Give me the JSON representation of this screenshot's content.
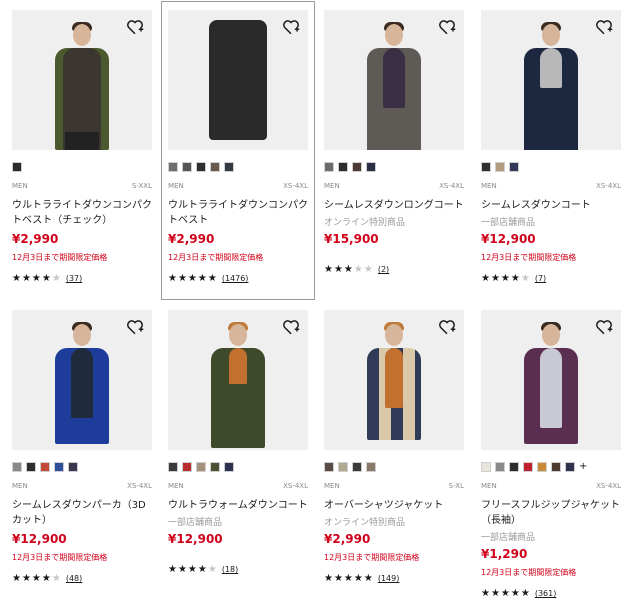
{
  "products": [
    {
      "gender": "MEN",
      "size": "S-XXL",
      "name": "ウルトラライトダウンコンパクトベスト（チェック）",
      "tag": "",
      "price": "¥2,990",
      "note": "12月3日まで期間限定価格",
      "rating": 4,
      "count": "(37)",
      "swatches": [
        "#2b2b2b"
      ],
      "coat": "#3d3a31"
    },
    {
      "gender": "MEN",
      "size": "XS-4XL",
      "name": "ウルトラライトダウンコンパクトベスト",
      "tag": "",
      "price": "¥2,990",
      "note": "12月3日まで期間限定価格",
      "rating": 4.5,
      "count": "(1476)",
      "swatches": [
        "#6f6f6f",
        "#555555",
        "#2f2f2f",
        "#6b5a4c",
        "#333a45"
      ],
      "coat": "#2a2a2a"
    },
    {
      "gender": "MEN",
      "size": "XS-4XL",
      "name": "シームレスダウンロングコート",
      "tag": "オンライン特別商品",
      "price": "¥15,900",
      "note": "",
      "rating": 2.5,
      "count": "(2)",
      "swatches": [
        "#6c6c6c",
        "#2d2d2d",
        "#4a3a33",
        "#2b2f45"
      ],
      "coat": "#5e5b57"
    },
    {
      "gender": "MEN",
      "size": "XS-4XL",
      "name": "シームレスダウンコート",
      "tag": "一部店舗商品",
      "price": "¥12,900",
      "note": "12月3日まで期間限定価格",
      "rating": 3.5,
      "count": "(7)",
      "swatches": [
        "#2f2f2f",
        "#b19c80",
        "#303a57"
      ],
      "coat": "#1e2740"
    },
    {
      "gender": "MEN",
      "size": "XS-4XL",
      "name": "シームレスダウンパーカ（3Dカット）",
      "tag": "",
      "price": "¥12,900",
      "note": "12月3日まで期間限定価格",
      "rating": 3.5,
      "count": "(48)",
      "swatches": [
        "#8a8a8a",
        "#2d2d2d",
        "#c24a37",
        "#2f4f9a",
        "#3d3650"
      ],
      "coat": "#1e3c9a"
    },
    {
      "gender": "MEN",
      "size": "XS-4XL",
      "name": "ウルトラウォームダウンコート",
      "tag": "一部店舗商品",
      "price": "¥12,900",
      "note": "",
      "rating": 3.5,
      "count": "(18)",
      "swatches": [
        "#3a3a3a",
        "#b52d2d",
        "#a4907d",
        "#4b5233",
        "#2c3350"
      ],
      "coat": "#3f4a2a"
    },
    {
      "gender": "MEN",
      "size": "S-XL",
      "name": "オーバーシャツジャケット",
      "tag": "オンライン特別商品",
      "price": "¥2,990",
      "note": "12月3日まで期間限定価格",
      "rating": 4.5,
      "count": "(149)",
      "swatches": [
        "#5a4b42",
        "#b3a890",
        "#3a3a3a",
        "#8a7a6a"
      ],
      "coat": "#2f3b57"
    },
    {
      "gender": "MEN",
      "size": "XS-4XL",
      "name": "フリースフルジップジャケット（長袖）",
      "tag": "一部店舗商品",
      "price": "¥1,290",
      "note": "12月3日まで期間限定価格",
      "rating": 4.5,
      "count": "(361)",
      "swatches": [
        "#e8e4dc",
        "#8a8a8a",
        "#2d2d2d",
        "#c01f2f",
        "#c98a3a",
        "#4c3a2e",
        "#2f3350"
      ],
      "coat": "#5a2e50"
    }
  ]
}
